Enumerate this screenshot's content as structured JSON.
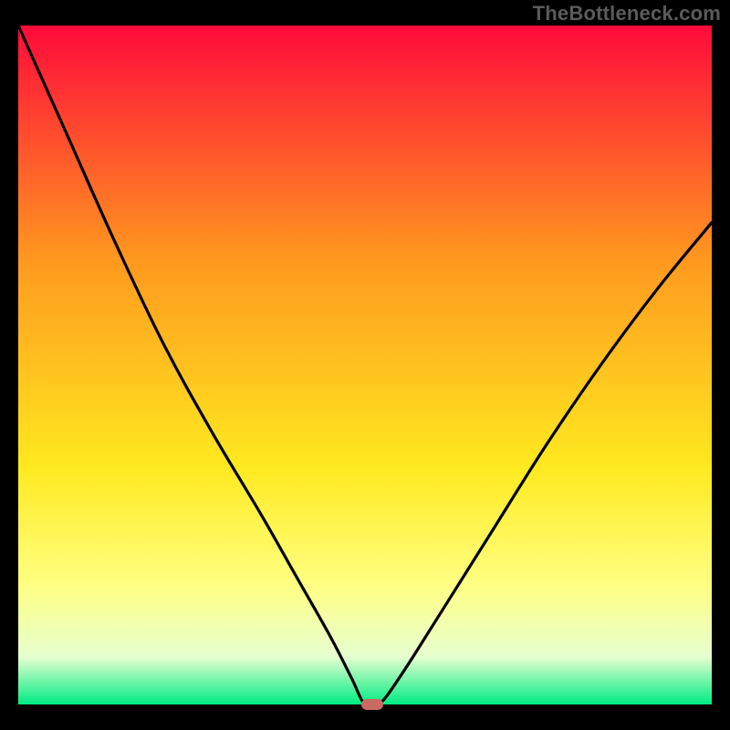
{
  "watermark": "TheBottleneck.com",
  "colors": {
    "page_background": "#000000",
    "curve_stroke": "#000000",
    "marker_fill": "#cb6a62",
    "watermark_text": "#5b5b5b",
    "gradient_top": "#ff0a3a",
    "gradient_mid_upper": "#ff9a1f",
    "gradient_mid": "#ffe91f",
    "gradient_mid_lower": "#ffff80",
    "gradient_near_bottom": "#e7ffd0",
    "gradient_bottom": "#00ec83"
  },
  "chart_data": {
    "type": "line",
    "title": "",
    "xlabel": "",
    "ylabel": "",
    "xlim": [
      0,
      100
    ],
    "ylim": [
      0,
      100
    ],
    "x": [
      0,
      7,
      14,
      21,
      28,
      35,
      40,
      45,
      48,
      50,
      52,
      55,
      60,
      68,
      76,
      84,
      92,
      100
    ],
    "values": [
      100,
      84,
      68,
      53,
      40,
      28,
      19,
      10,
      4,
      0,
      0,
      4,
      12,
      25,
      38,
      50,
      61,
      71
    ],
    "minimum_x": 51,
    "minimum_y": 0,
    "background_gradient_stops": [
      {
        "offset": 0.0,
        "color": "#ff0a3a"
      },
      {
        "offset": 0.35,
        "color": "#ff9a1f"
      },
      {
        "offset": 0.65,
        "color": "#ffe91f"
      },
      {
        "offset": 0.82,
        "color": "#ffff80"
      },
      {
        "offset": 0.93,
        "color": "#e7ffd0"
      },
      {
        "offset": 1.0,
        "color": "#00ec83"
      }
    ],
    "marker": {
      "x": 51,
      "y": 0,
      "shape": "rounded-rect",
      "color": "#cb6a62"
    }
  }
}
